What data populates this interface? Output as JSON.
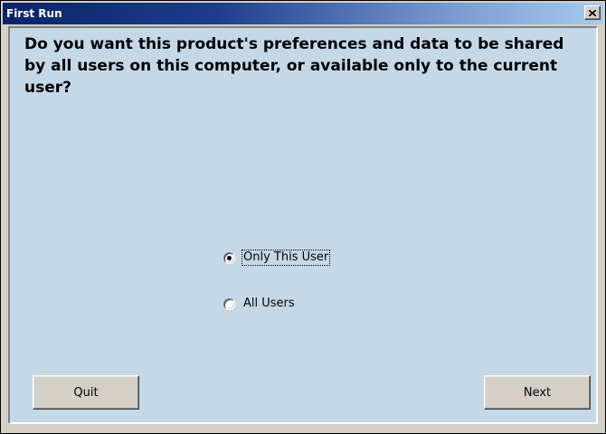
{
  "window": {
    "title": "First Run",
    "close_icon": "close-x-icon"
  },
  "dialog": {
    "question": "Do you want this product's preferences and data to be shared by all users on this computer, or available only to the current user?"
  },
  "options": [
    {
      "label": "Only This User",
      "selected": true,
      "focused": true
    },
    {
      "label": "All Users",
      "selected": false,
      "focused": false
    }
  ],
  "buttons": {
    "quit_label": "Quit",
    "next_label": "Next"
  },
  "colors": {
    "titlebar_start": "#0a246a",
    "titlebar_end": "#a6caf0",
    "client_background": "#c5d8e8",
    "button_face": "#d4d0c8"
  }
}
